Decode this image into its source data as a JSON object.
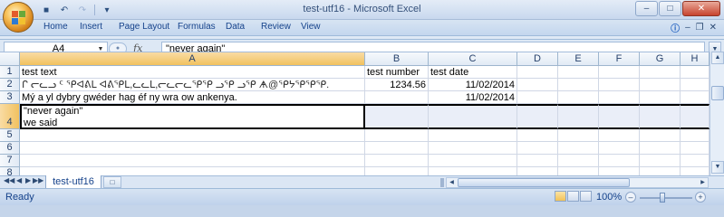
{
  "window": {
    "title": "test-utf16 - Microsoft Excel"
  },
  "ribbon": {
    "tabs": [
      "Home",
      "Insert",
      "Page Layout",
      "Formulas",
      "Data",
      "Review",
      "View"
    ]
  },
  "formula_bar": {
    "name_box": "A4",
    "content": "\"never again\""
  },
  "grid": {
    "columns": [
      "A",
      "B",
      "C",
      "D",
      "E",
      "F",
      "G",
      "H"
    ],
    "rows": [
      "1",
      "2",
      "3",
      "4",
      "5",
      "6",
      "7",
      "8"
    ],
    "cells": {
      "A1": "test text",
      "B1": "test number",
      "C1": "test date",
      "A2": "ᒋ ᓕᓚᓗ ᑦ ᕿᐊᕕᒪ ᐊᕕᕿᒪ,ᓚᓚᒪ,ᓕᓚᓕᓚᕿᕿ ᓗᕿ ᓗᕿ ᗗ@ᕿᔭᕿᕿᕿ.",
      "B2": "1234.56",
      "C2": "11/02/2014",
      "A3": "Mý a yl dybry gwéder hag éf ny wra ow ankenya.",
      "C3": "11/02/2014",
      "A4_line1": "\"never again\"",
      "A4_line2": "we said"
    }
  },
  "sheets": {
    "active": "test-utf16"
  },
  "status": {
    "mode": "Ready",
    "zoom": "100%"
  }
}
